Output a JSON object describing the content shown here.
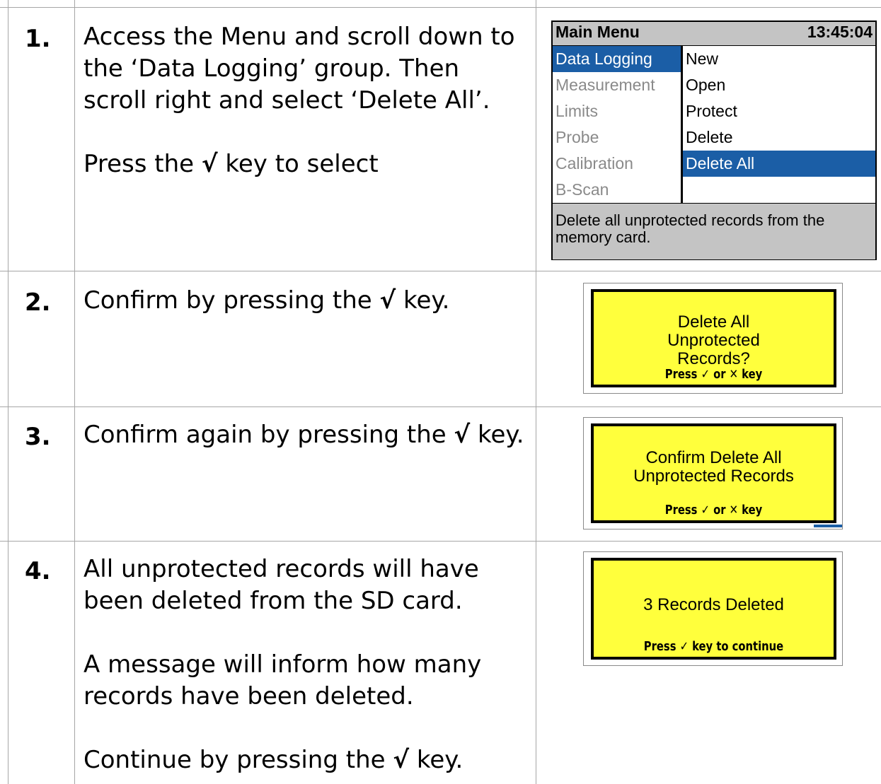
{
  "steps": [
    {
      "number": "1.",
      "text": [
        "Access the Menu and scroll down to the ‘Data Logging’ group. Then scroll right and select ‘Delete All’."
      ],
      "press_prefix": "Press the ",
      "tick": "√",
      "press_suffix": " key to select"
    },
    {
      "number": "2.",
      "prefix": "Confirm by pressing the ",
      "tick": "√",
      "suffix": " key."
    },
    {
      "number": "3.",
      "prefix": "Confirm again by pressing the ",
      "tick": "√",
      "suffix": " key."
    },
    {
      "number": "4.",
      "line1": "All unprotected records will have been deleted from the SD card.",
      "line2": "A message will inform how many records have been deleted.",
      "prefix": "Continue by pressing the ",
      "tick": "√",
      "suffix": " key."
    }
  ],
  "main_menu": {
    "title": "Main Menu",
    "time": "13:45:04",
    "groups": [
      "Data Logging",
      "Measurement",
      "Limits",
      "Probe",
      "Calibration",
      "B-Scan"
    ],
    "selected_group": "Data Logging",
    "items": [
      "New",
      "Open",
      "Protect",
      "Delete",
      "Delete All"
    ],
    "selected_item": "Delete All",
    "help_text": "Delete all unprotected records from the memory card.",
    "colors": {
      "header_bg": "#c4c4c4",
      "selection_bg": "#1b5ea6",
      "dim_text": "#8a8a8a"
    }
  },
  "dialogs": [
    {
      "message": "Delete All Unprotected Records?",
      "prompt": "Press ✓ or ✕ key"
    },
    {
      "message": "Confirm Delete All Unprotected Records",
      "prompt": "Press ✓ or ✕ key"
    },
    {
      "message": "3 Records Deleted",
      "prompt": "Press ✓ key to continue"
    }
  ],
  "colors": {
    "dialog_bg": "#ffff3c",
    "grid_lines": "#a6a6a6"
  }
}
